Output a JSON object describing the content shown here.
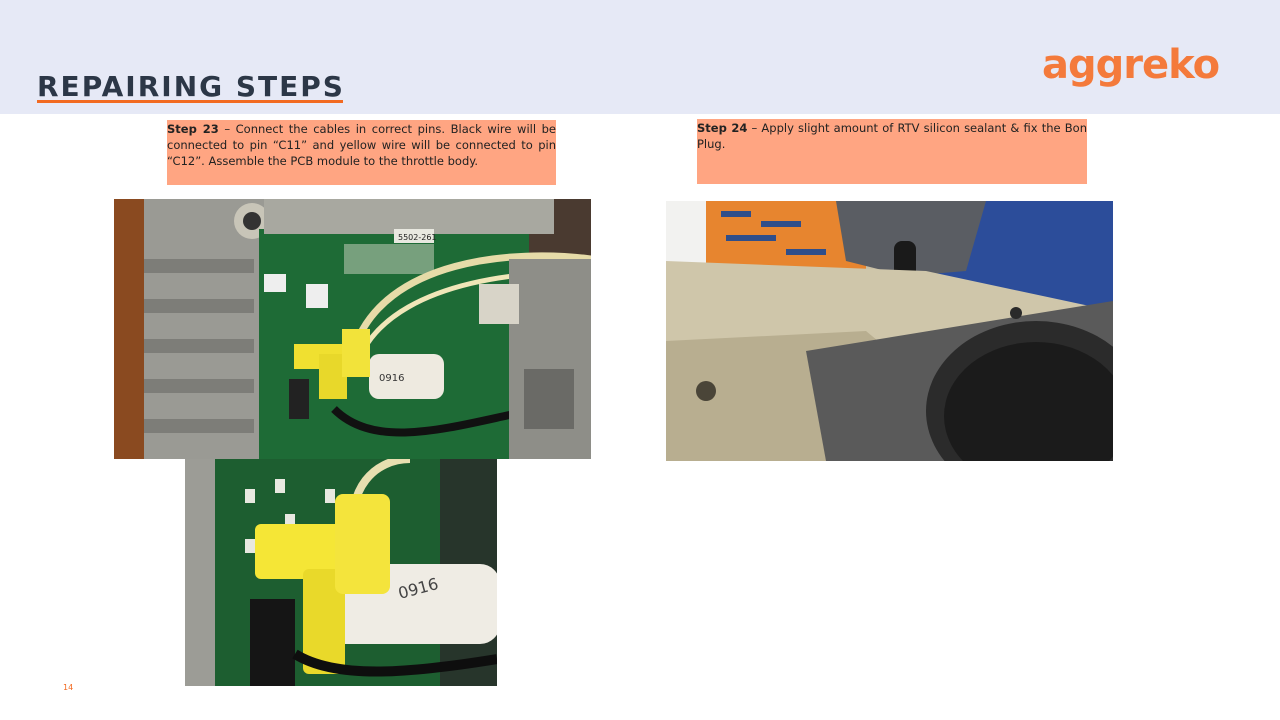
{
  "slide": {
    "title": "REPAIRING STEPS",
    "logo_text": "aggreko",
    "page_number": "14"
  },
  "steps": [
    {
      "label": "Step 23",
      "text": " – Connect the cables in correct pins. Black wire will be connected to pin “C11” and yellow wire will be connected to pin “C12”. Assemble the PCB module to the throttle body."
    },
    {
      "label": "Step 24",
      "text": " – Apply slight amount of RTV silicon sealant & fix the Bon Plug."
    }
  ],
  "photos": {
    "pcb_overview": {
      "label_sticker": "0916",
      "board_label": "5502-261"
    },
    "pcb_closeup": {
      "label_sticker": "0916"
    }
  },
  "colors": {
    "header_band": "#e6e9f6",
    "title": "#2c3747",
    "accent": "#f26a21",
    "step_box": "#ffa582",
    "logo": "#f47a3b"
  }
}
